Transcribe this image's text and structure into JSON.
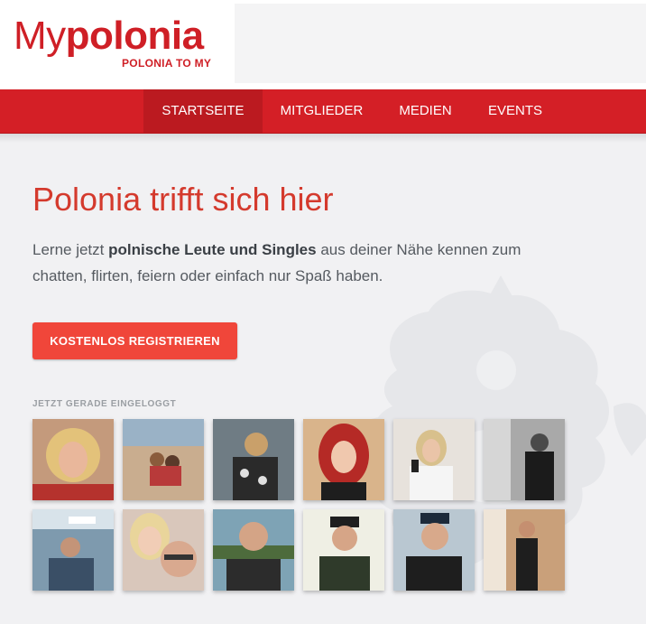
{
  "header": {
    "logo_my": "My",
    "logo_brand": "polonia",
    "logo_tagline": "POLONIA TO MY"
  },
  "nav": {
    "items": [
      {
        "label": "STARTSEITE",
        "active": true
      },
      {
        "label": "MITGLIEDER",
        "active": false
      },
      {
        "label": "MEDIEN",
        "active": false
      },
      {
        "label": "EVENTS",
        "active": false
      }
    ]
  },
  "hero": {
    "headline": "Polonia trifft sich hier",
    "intro_before": "Lerne jetzt ",
    "intro_bold": "polnische Leute und Singles",
    "intro_after": " aus deiner Nähe kennen zum chatten, flirten, feiern oder einfach nur Spaß haben.",
    "cta_label": "KOSTENLOS REGISTRIEREN"
  },
  "online": {
    "label": "JETZT GERADE EINGELOGGT",
    "members_count_shown": 12
  },
  "colors": {
    "brand_red": "#d41f26",
    "accent_red": "#f0463a",
    "headline_red": "#d43a2d",
    "background": "#f1f1f3"
  }
}
